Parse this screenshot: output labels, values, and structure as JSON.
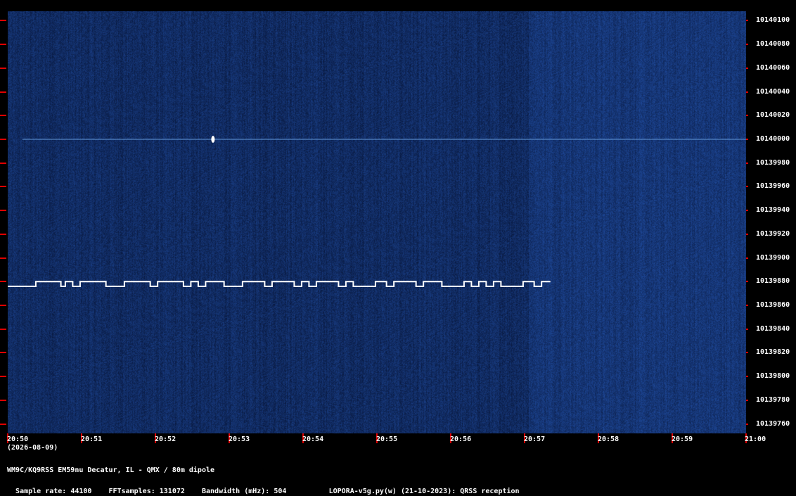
{
  "colors": {
    "background": "#000000",
    "waterfall": "#0c2049",
    "tick": "#e00000",
    "signal": "#ffffff",
    "carrier": "#5d8fd0"
  },
  "chart_data": {
    "type": "heatmap",
    "title": "",
    "xlabel": "",
    "ylabel": "",
    "x_ticks": [
      "20:50",
      "20:51",
      "20:52",
      "20:53",
      "20:54",
      "20:55",
      "20:56",
      "20:57",
      "20:58",
      "20:59",
      "21:00"
    ],
    "date_label": "(2026-08-09)",
    "y_ticks": [
      "10140100",
      "10140080",
      "10140060",
      "10140040",
      "10140020",
      "10140000",
      "10139980",
      "10139960",
      "10139940",
      "10139920",
      "10139900",
      "10139880",
      "10139860",
      "10139840",
      "10139820",
      "10139800",
      "10139780",
      "10139760"
    ],
    "ylim": [
      10139752,
      10140108
    ],
    "xlim_minutes": [
      0,
      10
    ],
    "carrier_line_hz": 10140000,
    "qrss_signal": {
      "freq_low_hz": 10139876,
      "freq_high_hz": 10139880,
      "start_min": 0,
      "end_min": 7.35,
      "segments": [
        [
          0,
          0.38,
          0
        ],
        [
          0.38,
          0.72,
          1
        ],
        [
          0.72,
          0.78,
          0
        ],
        [
          0.78,
          0.88,
          1
        ],
        [
          0.88,
          0.98,
          0
        ],
        [
          0.98,
          1.33,
          1
        ],
        [
          1.33,
          1.58,
          0
        ],
        [
          1.58,
          1.93,
          1
        ],
        [
          1.93,
          2.03,
          0
        ],
        [
          2.03,
          2.38,
          1
        ],
        [
          2.38,
          2.48,
          0
        ],
        [
          2.48,
          2.58,
          1
        ],
        [
          2.58,
          2.68,
          0
        ],
        [
          2.68,
          2.93,
          1
        ],
        [
          2.93,
          3.18,
          0
        ],
        [
          3.18,
          3.48,
          1
        ],
        [
          3.48,
          3.58,
          0
        ],
        [
          3.58,
          3.88,
          1
        ],
        [
          3.88,
          3.98,
          0
        ],
        [
          3.98,
          4.08,
          1
        ],
        [
          4.08,
          4.18,
          0
        ],
        [
          4.18,
          4.48,
          1
        ],
        [
          4.48,
          4.58,
          0
        ],
        [
          4.58,
          4.68,
          1
        ],
        [
          4.68,
          4.98,
          0
        ],
        [
          4.98,
          5.13,
          1
        ],
        [
          5.13,
          5.23,
          0
        ],
        [
          5.23,
          5.53,
          1
        ],
        [
          5.53,
          5.63,
          0
        ],
        [
          5.63,
          5.88,
          1
        ],
        [
          5.88,
          6.18,
          0
        ],
        [
          6.18,
          6.28,
          1
        ],
        [
          6.28,
          6.38,
          0
        ],
        [
          6.38,
          6.48,
          1
        ],
        [
          6.48,
          6.58,
          0
        ],
        [
          6.58,
          6.68,
          1
        ],
        [
          6.68,
          6.98,
          0
        ],
        [
          6.98,
          7.13,
          1
        ],
        [
          7.13,
          7.23,
          0
        ],
        [
          7.23,
          7.35,
          1
        ]
      ]
    }
  },
  "footer": {
    "line1": "WM9C/KQ9RSS EM59nu Decatur, IL - QMX / 80m dipole",
    "sample_rate": "Sample rate: 44100",
    "fft_samples": "FFTsamples: 131072",
    "bandwidth": "Bandwidth (mHz): 504",
    "software": "LOPORA-v5g.py(w) (21-10-2023): QRSS reception"
  }
}
